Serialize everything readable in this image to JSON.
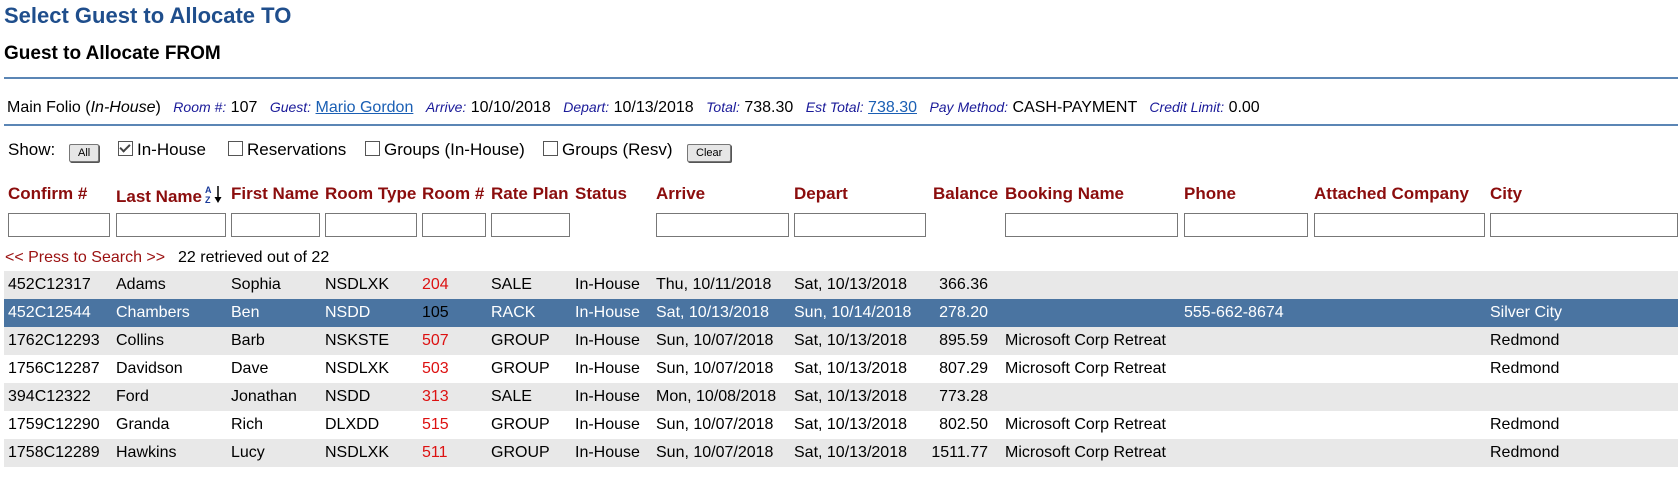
{
  "page_title": "Select Guest to Allocate TO",
  "sub_title": "Guest to Allocate FROM",
  "folio": {
    "main_folio": "Main Folio",
    "status": "In-House",
    "room_label": "Room #:",
    "room_value": "107",
    "guest_label": "Guest:",
    "guest_value": "Mario Gordon",
    "arrive_label": "Arrive:",
    "arrive_value": "10/10/2018",
    "depart_label": "Depart:",
    "depart_value": "10/13/2018",
    "total_label": "Total:",
    "total_value": "738.30",
    "est_total_label": "Est Total:",
    "est_total_value": "738.30",
    "pay_method_label": "Pay Method:",
    "pay_method_value": "CASH-PAYMENT",
    "credit_limit_label": "Credit Limit:",
    "credit_limit_value": "0.00"
  },
  "show": {
    "label": "Show:",
    "all_button": "All",
    "clear_button": "Clear",
    "filters": [
      {
        "label": "In-House",
        "checked": true
      },
      {
        "label": "Reservations",
        "checked": false
      },
      {
        "label": "Groups (In-House)",
        "checked": false
      },
      {
        "label": "Groups (Resv)",
        "checked": false
      }
    ]
  },
  "columns": [
    "Confirm #",
    "Last Name",
    "First Name",
    "Room Type",
    "Room #",
    "Rate Plan",
    "Status",
    "Arrive",
    "Depart",
    "Balance",
    "Booking Name",
    "Phone",
    "Attached Company",
    "City"
  ],
  "search_link": "<< Press to Search >>",
  "retrieved_text": "22 retrieved out of 22",
  "rows": [
    [
      "452C12317",
      "Adams",
      "Sophia",
      "NSDLXK",
      "204",
      "SALE",
      "In-House",
      "Thu, 10/11/2018",
      "Sat, 10/13/2018",
      "366.36",
      "",
      "",
      "",
      ""
    ],
    [
      "452C12544",
      "Chambers",
      "Ben",
      "NSDD",
      "105",
      "RACK",
      "In-House",
      "Sat, 10/13/2018",
      "Sun, 10/14/2018",
      "278.20",
      "",
      "555-662-8674",
      "",
      "Silver City"
    ],
    [
      "1762C12293",
      "Collins",
      "Barb",
      "NSKSTE",
      "507",
      "GROUP",
      "In-House",
      "Sun, 10/07/2018",
      "Sat, 10/13/2018",
      "895.59",
      "Microsoft Corp Retreat",
      "",
      "",
      "Redmond"
    ],
    [
      "1756C12287",
      "Davidson",
      "Dave",
      "NSDLXK",
      "503",
      "GROUP",
      "In-House",
      "Sun, 10/07/2018",
      "Sat, 10/13/2018",
      "807.29",
      "Microsoft Corp Retreat",
      "",
      "",
      "Redmond"
    ],
    [
      "394C12322",
      "Ford",
      "Jonathan",
      "NSDD",
      "313",
      "SALE",
      "In-House",
      "Mon, 10/08/2018",
      "Sat, 10/13/2018",
      "773.28",
      "",
      "",
      "",
      ""
    ],
    [
      "1759C12290",
      "Granda",
      "Rich",
      "DLXDD",
      "515",
      "GROUP",
      "In-House",
      "Sun, 10/07/2018",
      "Sat, 10/13/2018",
      "802.50",
      "Microsoft Corp Retreat",
      "",
      "",
      "Redmond"
    ],
    [
      "1758C12289",
      "Hawkins",
      "Lucy",
      "NSDLXK",
      "511",
      "GROUP",
      "In-House",
      "Sun, 10/07/2018",
      "Sat, 10/13/2018",
      "1511.77",
      "Microsoft Corp Retreat",
      "",
      "",
      "Redmond"
    ]
  ],
  "selected_row": 1,
  "colors": {
    "accent": "#1f4e8c",
    "header_red": "#8b0d0d",
    "selected_row": "#4a74a1",
    "room_red": "#dd1111"
  }
}
